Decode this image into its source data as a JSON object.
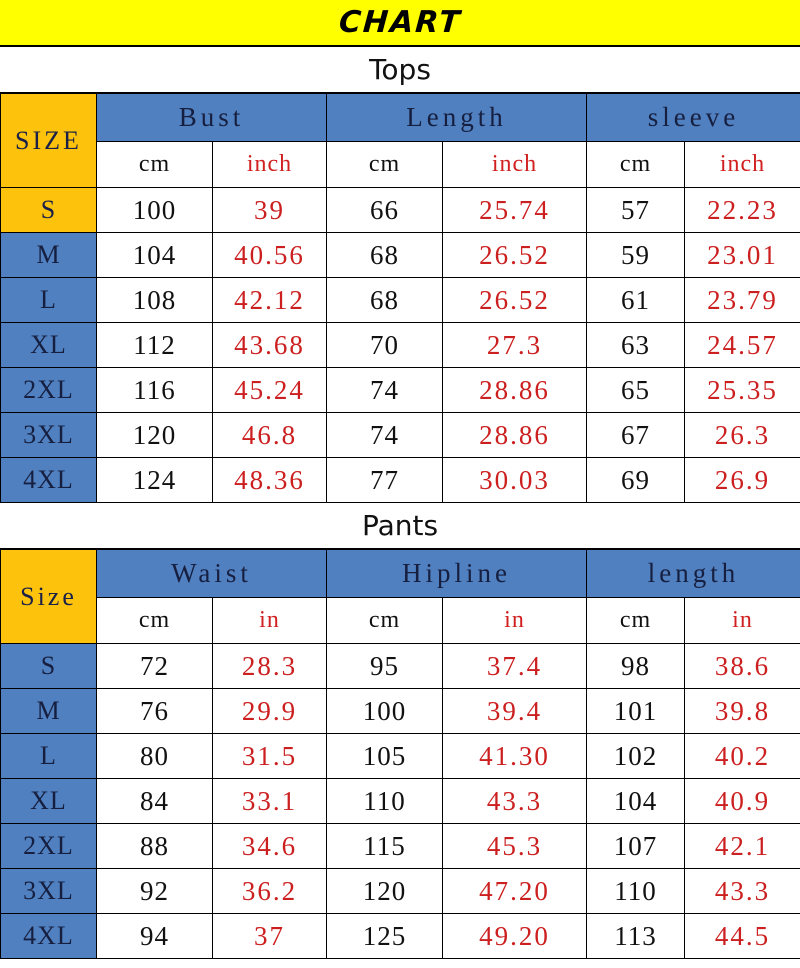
{
  "title": {
    "text": "CHART",
    "background_color": "#FFFF00",
    "text_color": "#000000"
  },
  "colors": {
    "header_blue": "#5080C0",
    "size_orange": "#FCC20C",
    "inch_red": "#CC1F1F",
    "cm_black": "#111111",
    "header_text_navy": "#161F40",
    "title_yellow": "#FFFF00",
    "border": "#000000"
  },
  "sections": [
    {
      "label": "Tops",
      "size_header": "SIZE",
      "groups": [
        {
          "name": "Bust",
          "units": [
            "cm",
            "inch"
          ]
        },
        {
          "name": "Length",
          "units": [
            "cm",
            "inch"
          ]
        },
        {
          "name": "sleeve",
          "units": [
            "cm",
            "inch"
          ]
        }
      ],
      "rows": [
        {
          "size": "S",
          "size_cell_color": "orange",
          "values": [
            "100",
            "39",
            "66",
            "25.74",
            "57",
            "22.23"
          ]
        },
        {
          "size": "M",
          "size_cell_color": "blue",
          "values": [
            "104",
            "40.56",
            "68",
            "26.52",
            "59",
            "23.01"
          ]
        },
        {
          "size": "L",
          "size_cell_color": "blue",
          "values": [
            "108",
            "42.12",
            "68",
            "26.52",
            "61",
            "23.79"
          ]
        },
        {
          "size": "XL",
          "size_cell_color": "blue",
          "values": [
            "112",
            "43.68",
            "70",
            "27.3",
            "63",
            "24.57"
          ]
        },
        {
          "size": "2XL",
          "size_cell_color": "blue",
          "values": [
            "116",
            "45.24",
            "74",
            "28.86",
            "65",
            "25.35"
          ]
        },
        {
          "size": "3XL",
          "size_cell_color": "blue",
          "values": [
            "120",
            "46.8",
            "74",
            "28.86",
            "67",
            "26.3"
          ]
        },
        {
          "size": "4XL",
          "size_cell_color": "blue",
          "values": [
            "124",
            "48.36",
            "77",
            "30.03",
            "69",
            "26.9"
          ]
        }
      ]
    },
    {
      "label": "Pants",
      "size_header": "Size",
      "groups": [
        {
          "name": "Waist",
          "units": [
            "cm",
            "in"
          ]
        },
        {
          "name": "Hipline",
          "units": [
            "cm",
            "in"
          ]
        },
        {
          "name": "length",
          "units": [
            "cm",
            "in"
          ]
        }
      ],
      "rows": [
        {
          "size": "S",
          "size_cell_color": "blue",
          "values": [
            "72",
            "28.3",
            "95",
            "37.4",
            "98",
            "38.6"
          ]
        },
        {
          "size": "M",
          "size_cell_color": "blue",
          "values": [
            "76",
            "29.9",
            "100",
            "39.4",
            "101",
            "39.8"
          ]
        },
        {
          "size": "L",
          "size_cell_color": "blue",
          "values": [
            "80",
            "31.5",
            "105",
            "41.30",
            "102",
            "40.2"
          ]
        },
        {
          "size": "XL",
          "size_cell_color": "blue",
          "values": [
            "84",
            "33.1",
            "110",
            "43.3",
            "104",
            "40.9"
          ]
        },
        {
          "size": "2XL",
          "size_cell_color": "blue",
          "values": [
            "88",
            "34.6",
            "115",
            "45.3",
            "107",
            "42.1"
          ]
        },
        {
          "size": "3XL",
          "size_cell_color": "blue",
          "values": [
            "92",
            "36.2",
            "120",
            "47.20",
            "110",
            "43.3"
          ]
        },
        {
          "size": "4XL",
          "size_cell_color": "blue",
          "values": [
            "94",
            "37",
            "125",
            "49.20",
            "113",
            "44.5"
          ]
        }
      ]
    }
  ]
}
